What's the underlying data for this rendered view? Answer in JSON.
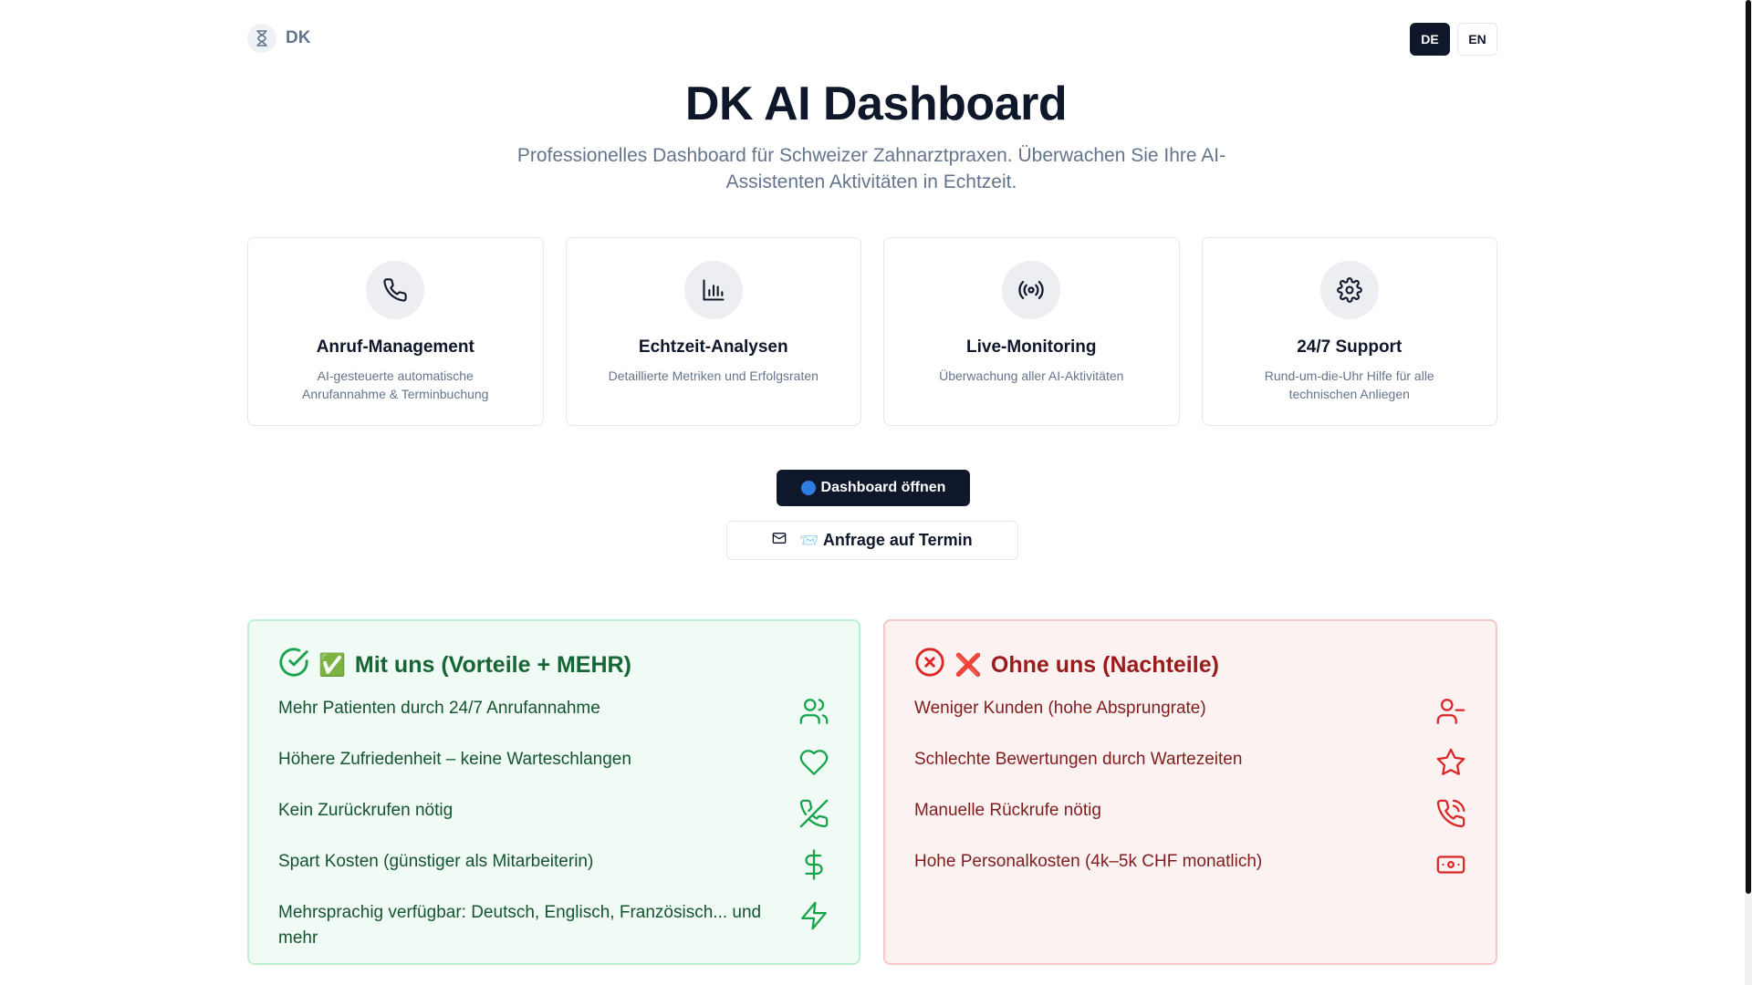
{
  "header": {
    "logo_text": "DK",
    "lang_de": "DE",
    "lang_en": "EN"
  },
  "hero": {
    "title": "DK AI Dashboard",
    "subtitle": "Professionelles Dashboard für Schweizer Zahnarztpraxen. Überwachen Sie Ihre AI-Assistenten Aktivitäten in Echtzeit."
  },
  "features": [
    {
      "icon": "phone-icon",
      "title": "Anruf-Management",
      "desc": "AI-gesteuerte automatische Anrufannahme & Terminbuchung"
    },
    {
      "icon": "bar-chart-icon",
      "title": "Echtzeit-Analysen",
      "desc": "Detaillierte Metriken und Erfolgsraten"
    },
    {
      "icon": "radio-icon",
      "title": "Live-Monitoring",
      "desc": "Überwachung aller AI-Aktivitäten"
    },
    {
      "icon": "settings-icon",
      "title": "24/7 Support",
      "desc": "Rund-um-die-Uhr Hilfe für alle technischen Anliegen"
    }
  ],
  "actions": {
    "open_dashboard": "Dashboard öffnen",
    "request_appointment": "Anfrage auf Termin",
    "request_emoji": "📨"
  },
  "pros": {
    "mark": "✅",
    "title": "Mit uns (Vorteile + MEHR)",
    "items": [
      {
        "text": "Mehr Patienten durch 24/7 Anrufannahme",
        "icon": "users-icon"
      },
      {
        "text": "Höhere Zufriedenheit – keine Warteschlangen",
        "icon": "heart-icon"
      },
      {
        "text": "Kein Zurückrufen nötig",
        "icon": "phone-off-icon"
      },
      {
        "text": "Spart Kosten (günstiger als Mitarbeiterin)",
        "icon": "dollar-icon"
      },
      {
        "text": "Mehrsprachig verfügbar: Deutsch, Englisch, Französisch... und mehr",
        "icon": "zap-icon"
      }
    ]
  },
  "cons": {
    "mark": "❌",
    "title": "Ohne uns (Nachteile)",
    "items": [
      {
        "text": "Weniger Kunden (hohe Absprungrate)",
        "icon": "user-minus-icon"
      },
      {
        "text": "Schlechte Bewertungen durch Wartezeiten",
        "icon": "star-icon"
      },
      {
        "text": "Manuelle Rückrufe nötig",
        "icon": "phone-call-icon"
      },
      {
        "text": "Hohe Personalkosten (4k–5k CHF monatlich)",
        "icon": "banknote-icon"
      }
    ]
  },
  "colors": {
    "primary": "#0f172a",
    "green_text": "#166534",
    "red_text": "#991b1b",
    "green_bg": "#f0fbf5",
    "red_bg": "#fdf2f2"
  }
}
